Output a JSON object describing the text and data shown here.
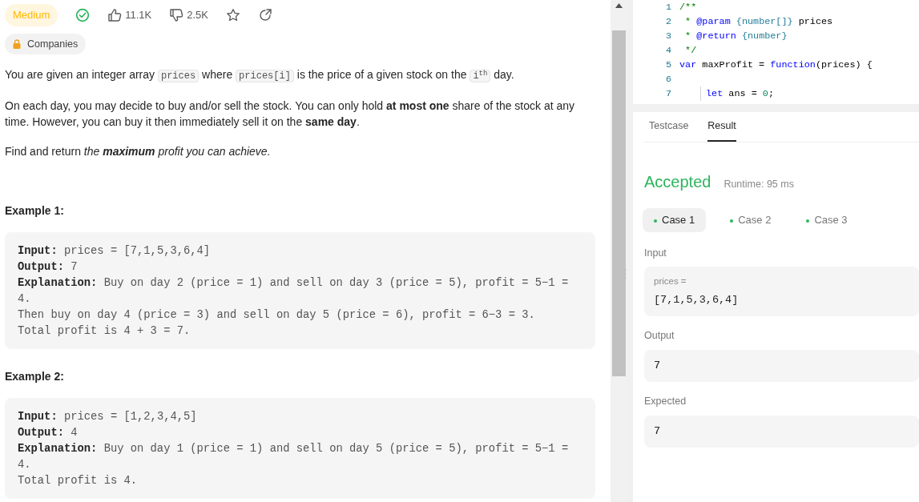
{
  "problem": {
    "difficulty": "Medium",
    "solved": true,
    "likes": "11.1K",
    "dislikes": "2.5K",
    "companies": "Companies",
    "description": [
      {
        "segments": [
          {
            "kind": "text",
            "text": "You are given an integer array "
          },
          {
            "kind": "code",
            "text": "prices"
          },
          {
            "kind": "text",
            "text": " where "
          },
          {
            "kind": "code",
            "text": "prices[i]"
          },
          {
            "kind": "text",
            "text": " is the price of a given stock on the "
          },
          {
            "kind": "code",
            "text": "i$^{th}$"
          },
          {
            "kind": "text",
            "text": " day."
          }
        ]
      },
      {
        "segments": [
          {
            "kind": "text",
            "text": "On each day, you may decide to buy and/or sell the stock. You can only hold **at most one** share of the stock at any time. However, you can buy it then immediately sell it on the **same day**."
          }
        ]
      },
      {
        "segments": [
          {
            "kind": "text",
            "text": "Find and return "
          },
          {
            "kind": "emphasis",
            "text": "the **maximum** profit you can achieve."
          }
        ]
      }
    ],
    "examples": [
      {
        "title": "Example 1:",
        "lines": [
          "**Input:** prices = [7,1,5,3,6,4]",
          "**Output:** 7",
          "**Explanation:** Buy on day 2 (price = 1) and sell on day 3 (price = 5), profit = 5−1 =",
          "4.",
          "Then buy on day 4 (price = 3) and sell on day 5 (price = 6), profit = 6−3 = 3.",
          "Total profit is 4 + 3 = 7."
        ]
      },
      {
        "title": "Example 2:",
        "lines": [
          "**Input:** prices = [1,2,3,4,5]",
          "**Output:** 4",
          "**Explanation:** Buy on day 1 (price = 1) and sell on day 5 (price = 5), profit = 5−1 =",
          "4.",
          "Total profit is 4."
        ]
      }
    ]
  },
  "editor": {
    "lines": [
      {
        "number": "1",
        "tokens": [
          {
            "kind": "comment",
            "text": "/**"
          }
        ]
      },
      {
        "number": "2",
        "tokens": [
          {
            "kind": "comment",
            "text": " * "
          },
          {
            "kind": "tag",
            "text": "@param"
          },
          {
            "kind": "type",
            "text": " {number[]}"
          },
          {
            "kind": "plain",
            "text": " prices"
          }
        ]
      },
      {
        "number": "3",
        "tokens": [
          {
            "kind": "comment",
            "text": " * "
          },
          {
            "kind": "tag",
            "text": "@return"
          },
          {
            "kind": "type",
            "text": " {number}"
          }
        ]
      },
      {
        "number": "4",
        "tokens": [
          {
            "kind": "comment",
            "text": " */"
          }
        ]
      },
      {
        "number": "5",
        "tokens": [
          {
            "kind": "keyword",
            "text": "var"
          },
          {
            "kind": "plain",
            "text": " maxProfit = "
          },
          {
            "kind": "keyword",
            "text": "function"
          },
          {
            "kind": "plain",
            "text": "(prices) {"
          }
        ]
      },
      {
        "number": "6"
      },
      {
        "number": "7",
        "tokens": [
          {
            "kind": "keyword",
            "text": "let"
          },
          {
            "kind": "plain",
            "text": " ans = "
          },
          {
            "kind": "number",
            "text": "0"
          },
          {
            "kind": "plain",
            "text": ";"
          }
        ]
      }
    ]
  },
  "result_panel": {
    "tabs": [
      {
        "label": "Testcase",
        "selected": false
      },
      {
        "label": "Result",
        "selected": true
      }
    ],
    "status": "Accepted",
    "runtime": "Runtime: 95 ms",
    "cases": [
      {
        "label": "Case 1",
        "selected": true,
        "passed": true
      },
      {
        "label": "Case 2",
        "selected": false,
        "passed": true
      },
      {
        "label": "Case 3",
        "selected": false,
        "passed": true
      }
    ],
    "input": {
      "label": "Input",
      "param": "prices =",
      "value": "[7,1,5,3,6,4]"
    },
    "output": {
      "label": "Output",
      "value": "7"
    },
    "expected": {
      "label": "Expected",
      "value": "7"
    }
  }
}
